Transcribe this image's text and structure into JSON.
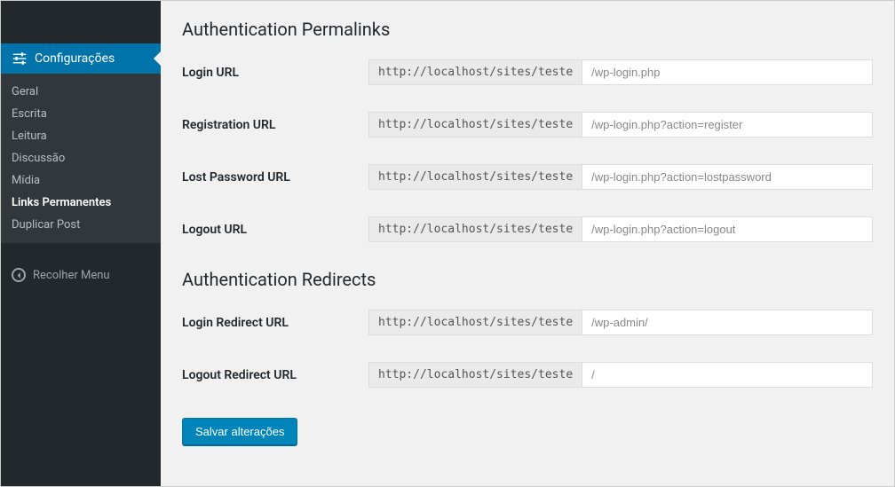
{
  "sidebar": {
    "settings_label": "Configurações",
    "subitems": [
      {
        "label": "Geral",
        "current": false
      },
      {
        "label": "Escrita",
        "current": false
      },
      {
        "label": "Leitura",
        "current": false
      },
      {
        "label": "Discussão",
        "current": false
      },
      {
        "label": "Mídia",
        "current": false
      },
      {
        "label": "Links Permanentes",
        "current": true
      },
      {
        "label": "Duplicar Post",
        "current": false
      }
    ],
    "collapse_label": "Recolher Menu"
  },
  "sections": {
    "auth_permalinks_title": "Authentication Permalinks",
    "auth_redirects_title": "Authentication Redirects"
  },
  "url_prefix": "http://localhost/sites/teste",
  "fields": {
    "login_url": {
      "label": "Login URL",
      "value": "/wp-login.php"
    },
    "registration_url": {
      "label": "Registration URL",
      "value": "/wp-login.php?action=register"
    },
    "lost_password_url": {
      "label": "Lost Password URL",
      "value": "/wp-login.php?action=lostpassword"
    },
    "logout_url": {
      "label": "Logout URL",
      "value": "/wp-login.php?action=logout"
    },
    "login_redirect_url": {
      "label": "Login Redirect URL",
      "value": "/wp-admin/"
    },
    "logout_redirect_url": {
      "label": "Logout Redirect URL",
      "value": "/"
    }
  },
  "submit_label": "Salvar alterações"
}
